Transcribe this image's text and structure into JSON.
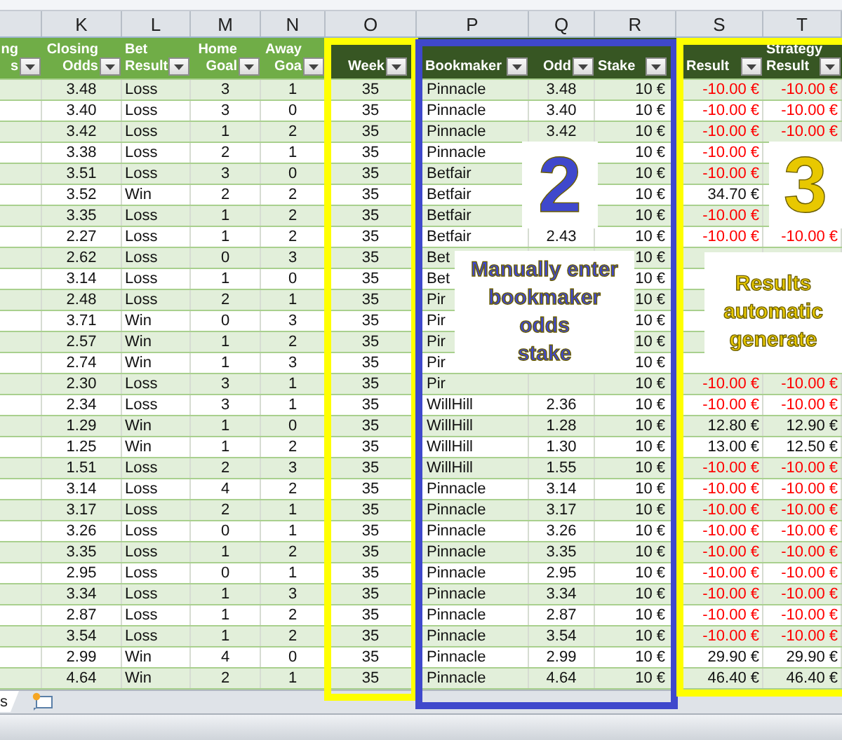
{
  "column_letters": [
    "K",
    "L",
    "M",
    "N",
    "O",
    "P",
    "Q",
    "R",
    "S",
    "T"
  ],
  "headers": [
    {
      "lines": [
        "ng",
        "s"
      ],
      "color": "#70ad47"
    },
    {
      "lines": [
        "Closing",
        "Odds"
      ],
      "color": "#70ad47"
    },
    {
      "lines": [
        "Bet",
        "Result"
      ],
      "color": "#70ad47"
    },
    {
      "lines": [
        "Home",
        "Goal"
      ],
      "color": "#70ad47"
    },
    {
      "lines": [
        "Away",
        "Goa"
      ],
      "color": "#70ad47"
    },
    {
      "lines": [
        "Week"
      ],
      "color": "#375623"
    },
    {
      "lines": [
        "Bookmaker"
      ],
      "color": "#375623"
    },
    {
      "lines": [
        "Odd"
      ],
      "color": "#375623"
    },
    {
      "lines": [
        "Stake"
      ],
      "color": "#375623"
    },
    {
      "lines": [
        "Result"
      ],
      "color": "#375623"
    },
    {
      "lines": [
        "Strategy",
        "Result"
      ],
      "color": "#375623"
    }
  ],
  "rows": [
    {
      "cells": [
        "3.48",
        "Loss",
        "3",
        "1",
        "35",
        "Pinnacle",
        "3.48",
        "10 €"
      ],
      "s": {
        "text": "-10.00 €",
        "negative": true
      },
      "t": {
        "text": "-10.00 €",
        "negative": true
      }
    },
    {
      "cells": [
        "3.40",
        "Loss",
        "3",
        "0",
        "35",
        "Pinnacle",
        "3.40",
        "10 €"
      ],
      "s": {
        "text": "-10.00 €",
        "negative": true
      },
      "t": {
        "text": "-10.00 €",
        "negative": true
      }
    },
    {
      "cells": [
        "3.42",
        "Loss",
        "1",
        "2",
        "35",
        "Pinnacle",
        "3.42",
        "10 €"
      ],
      "s": {
        "text": "-10.00 €",
        "negative": true
      },
      "t": {
        "text": "-10.00 €",
        "negative": true
      }
    },
    {
      "cells": [
        "3.38",
        "Loss",
        "2",
        "1",
        "35",
        "Pinnacle",
        null,
        "10 €"
      ],
      "s": {
        "text": "-10.00 €",
        "negative": true
      },
      "t": null
    },
    {
      "cells": [
        "3.51",
        "Loss",
        "3",
        "0",
        "35",
        "Betfair",
        null,
        "10 €"
      ],
      "s": {
        "text": "-10.00 €",
        "negative": true
      },
      "t": null
    },
    {
      "cells": [
        "3.52",
        "Win",
        "2",
        "2",
        "35",
        "Betfair",
        null,
        "10 €"
      ],
      "s": {
        "text": "34.70 €",
        "negative": false
      },
      "t": null
    },
    {
      "cells": [
        "3.35",
        "Loss",
        "1",
        "2",
        "35",
        "Betfair",
        null,
        "10 €"
      ],
      "s": {
        "text": "-10.00 €",
        "negative": true
      },
      "t": null
    },
    {
      "cells": [
        "2.27",
        "Loss",
        "1",
        "2",
        "35",
        "Betfair",
        "2.43",
        "10 €"
      ],
      "s": {
        "text": "-10.00 €",
        "negative": true
      },
      "t": {
        "text": "-10.00 €",
        "negative": true
      }
    },
    {
      "cells": [
        "2.62",
        "Loss",
        "0",
        "3",
        "35",
        "Bet",
        null,
        "10 €"
      ],
      "s": null,
      "t": null
    },
    {
      "cells": [
        "3.14",
        "Loss",
        "1",
        "0",
        "35",
        "Bet",
        null,
        "10 €"
      ],
      "s": null,
      "t": null
    },
    {
      "cells": [
        "2.48",
        "Loss",
        "2",
        "1",
        "35",
        "Pir",
        null,
        "10 €"
      ],
      "s": null,
      "t": null
    },
    {
      "cells": [
        "3.71",
        "Win",
        "0",
        "3",
        "35",
        "Pir",
        null,
        "10 €"
      ],
      "s": null,
      "t": null
    },
    {
      "cells": [
        "2.57",
        "Win",
        "1",
        "2",
        "35",
        "Pir",
        null,
        "10 €"
      ],
      "s": null,
      "t": null
    },
    {
      "cells": [
        "2.74",
        "Win",
        "1",
        "3",
        "35",
        "Pir",
        null,
        "10 €"
      ],
      "s": null,
      "t": null
    },
    {
      "cells": [
        "2.30",
        "Loss",
        "3",
        "1",
        "35",
        "Pir",
        null,
        "10 €"
      ],
      "s": {
        "text": "-10.00 €",
        "negative": true
      },
      "t": {
        "text": "-10.00 €",
        "negative": true
      }
    },
    {
      "cells": [
        "2.34",
        "Loss",
        "3",
        "1",
        "35",
        "WillHill",
        "2.36",
        "10 €"
      ],
      "s": {
        "text": "-10.00 €",
        "negative": true
      },
      "t": {
        "text": "-10.00 €",
        "negative": true
      }
    },
    {
      "cells": [
        "1.29",
        "Win",
        "1",
        "0",
        "35",
        "WillHill",
        "1.28",
        "10 €"
      ],
      "s": {
        "text": "12.80 €",
        "negative": false
      },
      "t": {
        "text": "12.90 €",
        "negative": false
      }
    },
    {
      "cells": [
        "1.25",
        "Win",
        "1",
        "2",
        "35",
        "WillHill",
        "1.30",
        "10 €"
      ],
      "s": {
        "text": "13.00 €",
        "negative": false
      },
      "t": {
        "text": "12.50 €",
        "negative": false
      }
    },
    {
      "cells": [
        "1.51",
        "Loss",
        "2",
        "3",
        "35",
        "WillHill",
        "1.55",
        "10 €"
      ],
      "s": {
        "text": "-10.00 €",
        "negative": true
      },
      "t": {
        "text": "-10.00 €",
        "negative": true
      }
    },
    {
      "cells": [
        "3.14",
        "Loss",
        "4",
        "2",
        "35",
        "Pinnacle",
        "3.14",
        "10 €"
      ],
      "s": {
        "text": "-10.00 €",
        "negative": true
      },
      "t": {
        "text": "-10.00 €",
        "negative": true
      }
    },
    {
      "cells": [
        "3.17",
        "Loss",
        "2",
        "1",
        "35",
        "Pinnacle",
        "3.17",
        "10 €"
      ],
      "s": {
        "text": "-10.00 €",
        "negative": true
      },
      "t": {
        "text": "-10.00 €",
        "negative": true
      }
    },
    {
      "cells": [
        "3.26",
        "Loss",
        "0",
        "1",
        "35",
        "Pinnacle",
        "3.26",
        "10 €"
      ],
      "s": {
        "text": "-10.00 €",
        "negative": true
      },
      "t": {
        "text": "-10.00 €",
        "negative": true
      }
    },
    {
      "cells": [
        "3.35",
        "Loss",
        "1",
        "2",
        "35",
        "Pinnacle",
        "3.35",
        "10 €"
      ],
      "s": {
        "text": "-10.00 €",
        "negative": true
      },
      "t": {
        "text": "-10.00 €",
        "negative": true
      }
    },
    {
      "cells": [
        "2.95",
        "Loss",
        "0",
        "1",
        "35",
        "Pinnacle",
        "2.95",
        "10 €"
      ],
      "s": {
        "text": "-10.00 €",
        "negative": true
      },
      "t": {
        "text": "-10.00 €",
        "negative": true
      }
    },
    {
      "cells": [
        "3.34",
        "Loss",
        "1",
        "3",
        "35",
        "Pinnacle",
        "3.34",
        "10 €"
      ],
      "s": {
        "text": "-10.00 €",
        "negative": true
      },
      "t": {
        "text": "-10.00 €",
        "negative": true
      }
    },
    {
      "cells": [
        "2.87",
        "Loss",
        "1",
        "2",
        "35",
        "Pinnacle",
        "2.87",
        "10 €"
      ],
      "s": {
        "text": "-10.00 €",
        "negative": true
      },
      "t": {
        "text": "-10.00 €",
        "negative": true
      }
    },
    {
      "cells": [
        "3.54",
        "Loss",
        "1",
        "2",
        "35",
        "Pinnacle",
        "3.54",
        "10 €"
      ],
      "s": {
        "text": "-10.00 €",
        "negative": true
      },
      "t": {
        "text": "-10.00 €",
        "negative": true
      }
    },
    {
      "cells": [
        "2.99",
        "Win",
        "4",
        "0",
        "35",
        "Pinnacle",
        "2.99",
        "10 €"
      ],
      "s": {
        "text": "29.90 €",
        "negative": false
      },
      "t": {
        "text": "29.90 €",
        "negative": false
      }
    },
    {
      "cells": [
        "4.64",
        "Win",
        "2",
        "1",
        "35",
        "Pinnacle",
        "4.64",
        "10 €"
      ],
      "s": {
        "text": "46.40 €",
        "negative": false
      },
      "t": {
        "text": "46.40 €",
        "negative": false
      }
    }
  ],
  "frames": [
    {
      "color": "#ffff00"
    },
    {
      "color": "#3f48cc"
    },
    {
      "color": "#ffff00"
    }
  ],
  "callouts": [
    {
      "kind": "number",
      "lines": [
        "2"
      ],
      "color": "#3f48cc"
    },
    {
      "kind": "note",
      "lines": [
        "Manually enter",
        "bookmaker",
        "odds",
        "stake"
      ],
      "color": "#3f48cc"
    },
    {
      "kind": "number",
      "lines": [
        "3"
      ],
      "color": "#e8c800"
    },
    {
      "kind": "note",
      "lines": [
        "Results",
        "automatic",
        "generate"
      ],
      "color": "#e8c800"
    }
  ],
  "sheet_tabs": [
    {
      "label": "s"
    }
  ]
}
